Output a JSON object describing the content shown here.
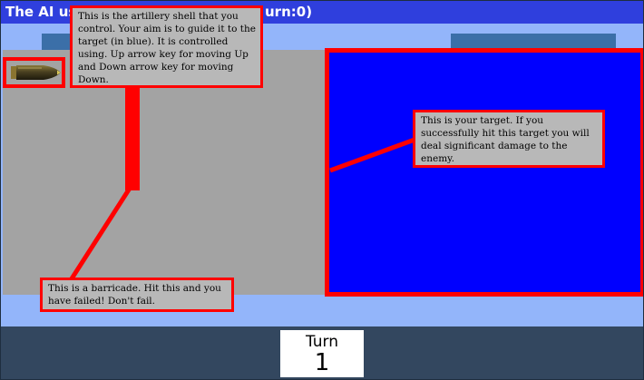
{
  "window": {
    "title_left": "The AI use",
    "title_right": "urn:0)"
  },
  "game": {
    "lane_color": "#a3a3a3",
    "target_color": "#0000ff",
    "highlight_color": "#ff0000",
    "playfield_color": "#93b5fa",
    "shell_icon": "artillery-shell-icon"
  },
  "tooltips": {
    "shell": "This is the artillery shell that you control. Your aim is to guide it to the target (in blue). It is controlled using. Up arrow key for moving Up and Down arrow key for moving Down.",
    "target": "This is your target. If you successfully hit this target you will deal significant damage to the enemy.",
    "barricade": "This is a barricade. Hit this and you have failed! Don't fail."
  },
  "turn": {
    "label": "Turn",
    "value": "1"
  }
}
